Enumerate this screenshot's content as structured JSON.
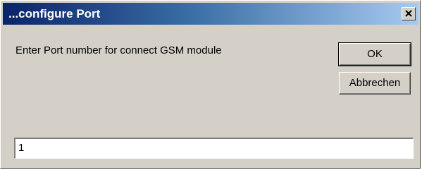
{
  "window": {
    "title": "...configure Port"
  },
  "dialog": {
    "prompt": "Enter Port number for connect GSM module",
    "ok_label": "OK",
    "cancel_label": "Abbrechen",
    "port_value": "1"
  },
  "icons": {
    "close": "close-icon"
  },
  "colors": {
    "title_gradient_start": "#0a246a",
    "title_gradient_end": "#a6caf0",
    "face": "#d4d0c8"
  }
}
